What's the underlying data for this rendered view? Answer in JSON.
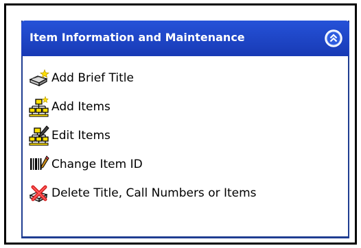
{
  "panel": {
    "title": "Item Information and Maintenance",
    "collapse_icon": "double-chevron-up-icon",
    "items": [
      {
        "label": "Add Brief Title",
        "icon": "add-title-icon"
      },
      {
        "label": "Add Items",
        "icon": "add-items-icon"
      },
      {
        "label": "Edit Items",
        "icon": "edit-items-icon"
      },
      {
        "label": "Change Item ID",
        "icon": "barcode-pencil-icon"
      },
      {
        "label": "Delete Title, Call Numbers or Items",
        "icon": "delete-icon"
      }
    ]
  },
  "colors": {
    "header_bg": "#1c45c4",
    "header_text": "#ffffff",
    "border": "#1f3d91"
  }
}
